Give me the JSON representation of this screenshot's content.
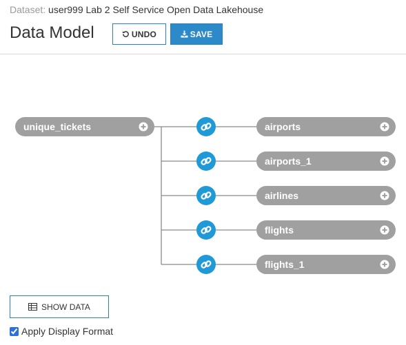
{
  "header": {
    "dataset_label": "Dataset:",
    "dataset_name": "user999 Lab 2 Self Service Open Data Lakehouse",
    "title": "Data Model"
  },
  "toolbar": {
    "undo_label": "UNDO",
    "save_label": "SAVE",
    "undo_icon": "undo-icon",
    "save_icon": "download-icon"
  },
  "model": {
    "root_table": "unique_tickets",
    "joined_tables": [
      {
        "name": "airports"
      },
      {
        "name": "airports_1"
      },
      {
        "name": "airlines"
      },
      {
        "name": "flights"
      },
      {
        "name": "flights_1"
      }
    ],
    "join_icon": "link-icon",
    "add_icon": "plus-circle-icon"
  },
  "footer": {
    "show_data_label": "SHOW DATA",
    "show_data_icon": "table-icon",
    "apply_display_format_label": "Apply Display Format",
    "apply_display_format_checked": true
  },
  "colors": {
    "accent": "#2d8ac9",
    "node_bg": "#a0a0a0",
    "join_icon_bg": "#1f9ad6",
    "connector": "#8a8a8a"
  }
}
